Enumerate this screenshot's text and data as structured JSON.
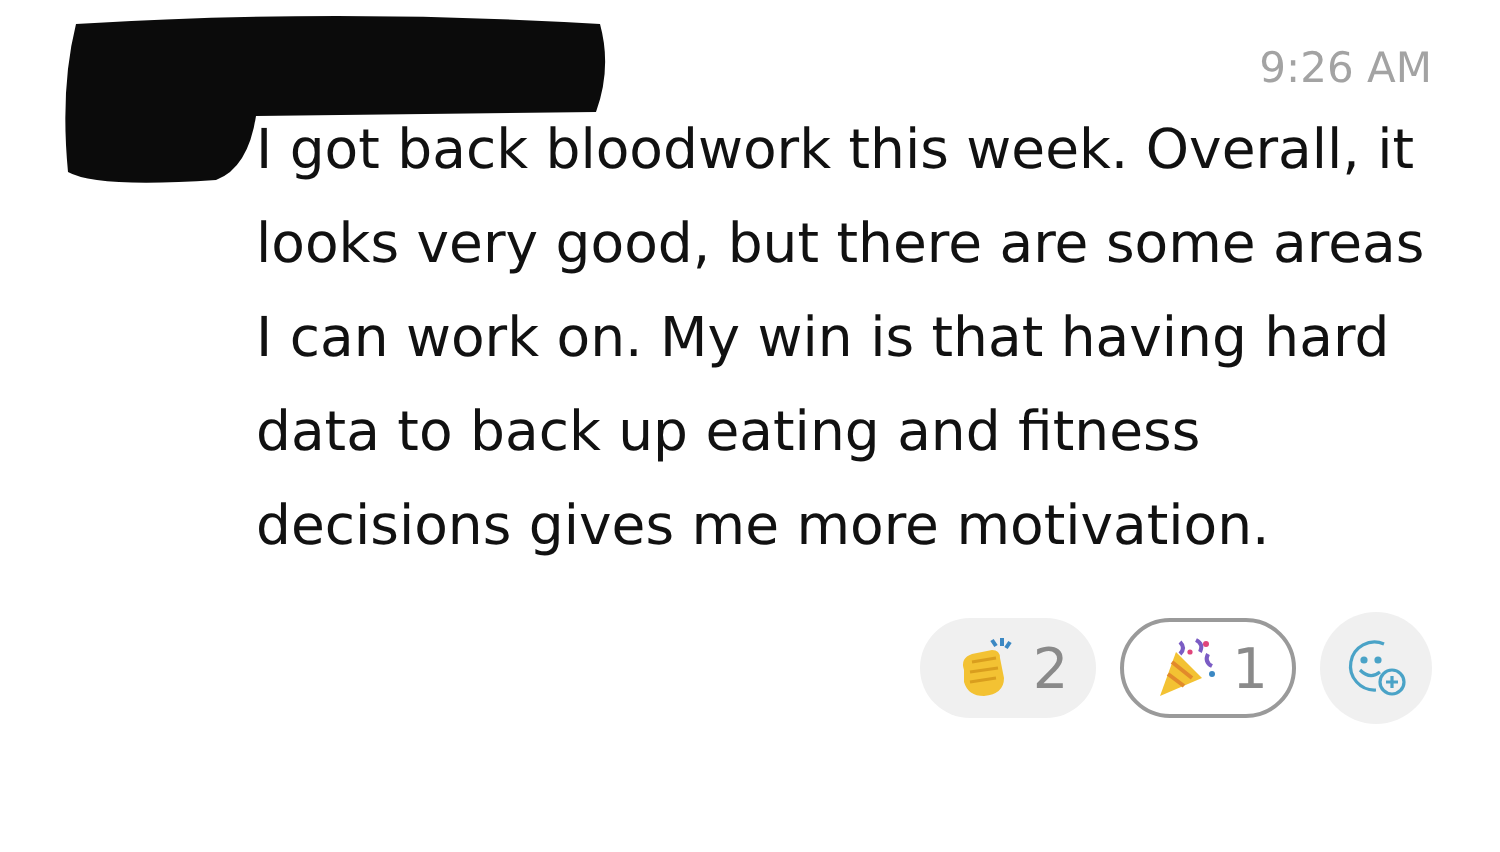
{
  "message": {
    "time": "9:26 AM",
    "text": "I got back bloodwork this week. Overall, it looks very good, but there are some areas I can work on. My win is that having hard data to back up eating and fitness decisions gives me more motivation.",
    "reactions": [
      {
        "kind": "clap",
        "count": "2",
        "selected": false
      },
      {
        "kind": "party",
        "count": "1",
        "selected": true
      }
    ]
  }
}
